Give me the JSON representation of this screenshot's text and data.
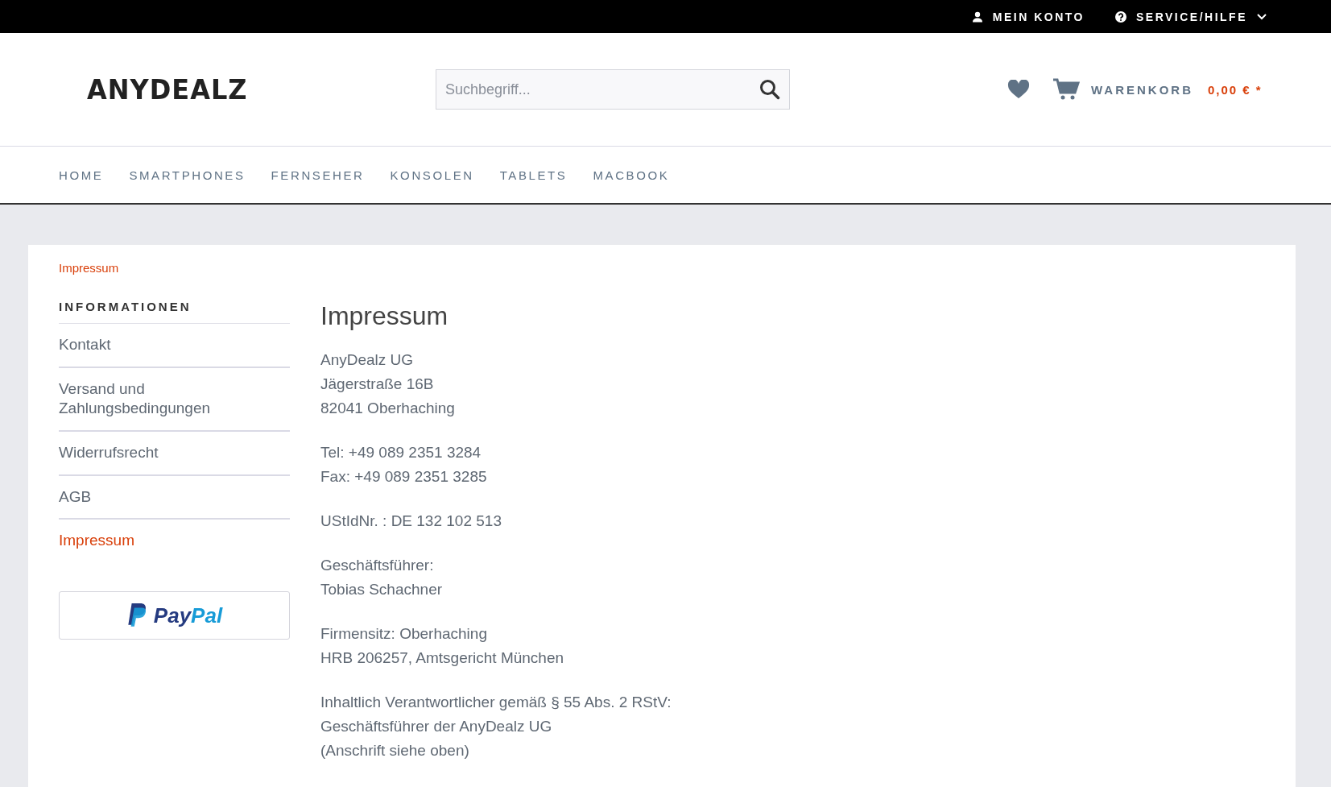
{
  "top_bar": {
    "account": "MEIN KONTO",
    "service": "SERVICE/HILFE"
  },
  "header": {
    "logo": "ANYDEALZ",
    "search": {
      "placeholder": "Suchbegriff..."
    },
    "cart": {
      "label": "WARENKORB",
      "total": "0,00 € *"
    }
  },
  "nav": [
    "HOME",
    "SMARTPHONES",
    "FERNSEHER",
    "KONSOLEN",
    "TABLETS",
    "MACBOOK"
  ],
  "breadcrumb": "Impressum",
  "sidebar": {
    "title": "INFORMATIONEN",
    "items": [
      {
        "label": "Kontakt",
        "selected": false
      },
      {
        "label": "Versand und Zahlungsbedingungen",
        "selected": false
      },
      {
        "label": "Widerrufsrecht",
        "selected": false
      },
      {
        "label": "AGB",
        "selected": false
      },
      {
        "label": "Impressum",
        "selected": true
      }
    ],
    "paypal": {
      "text_dark": "Pay",
      "text_light": "Pal"
    }
  },
  "content": {
    "title": "Impressum",
    "paragraphs": [
      [
        "AnyDealz UG",
        "Jägerstraße 16B",
        "82041 Oberhaching"
      ],
      [
        "Tel:  +49 089 2351 3284",
        "Fax: +49 089 2351 3285"
      ],
      [
        "UStIdNr. : DE 132 102 513"
      ],
      [
        "Geschäftsführer:",
        "Tobias Schachner"
      ],
      [
        "Firmensitz: Oberhaching",
        "HRB 206257, Amtsgericht München"
      ],
      [
        "Inhaltlich Verantwortlicher gemäß § 55 Abs. 2 RStV:",
        "Geschäftsführer der AnyDealz UG",
        "(Anschrift siehe oben)"
      ]
    ]
  }
}
